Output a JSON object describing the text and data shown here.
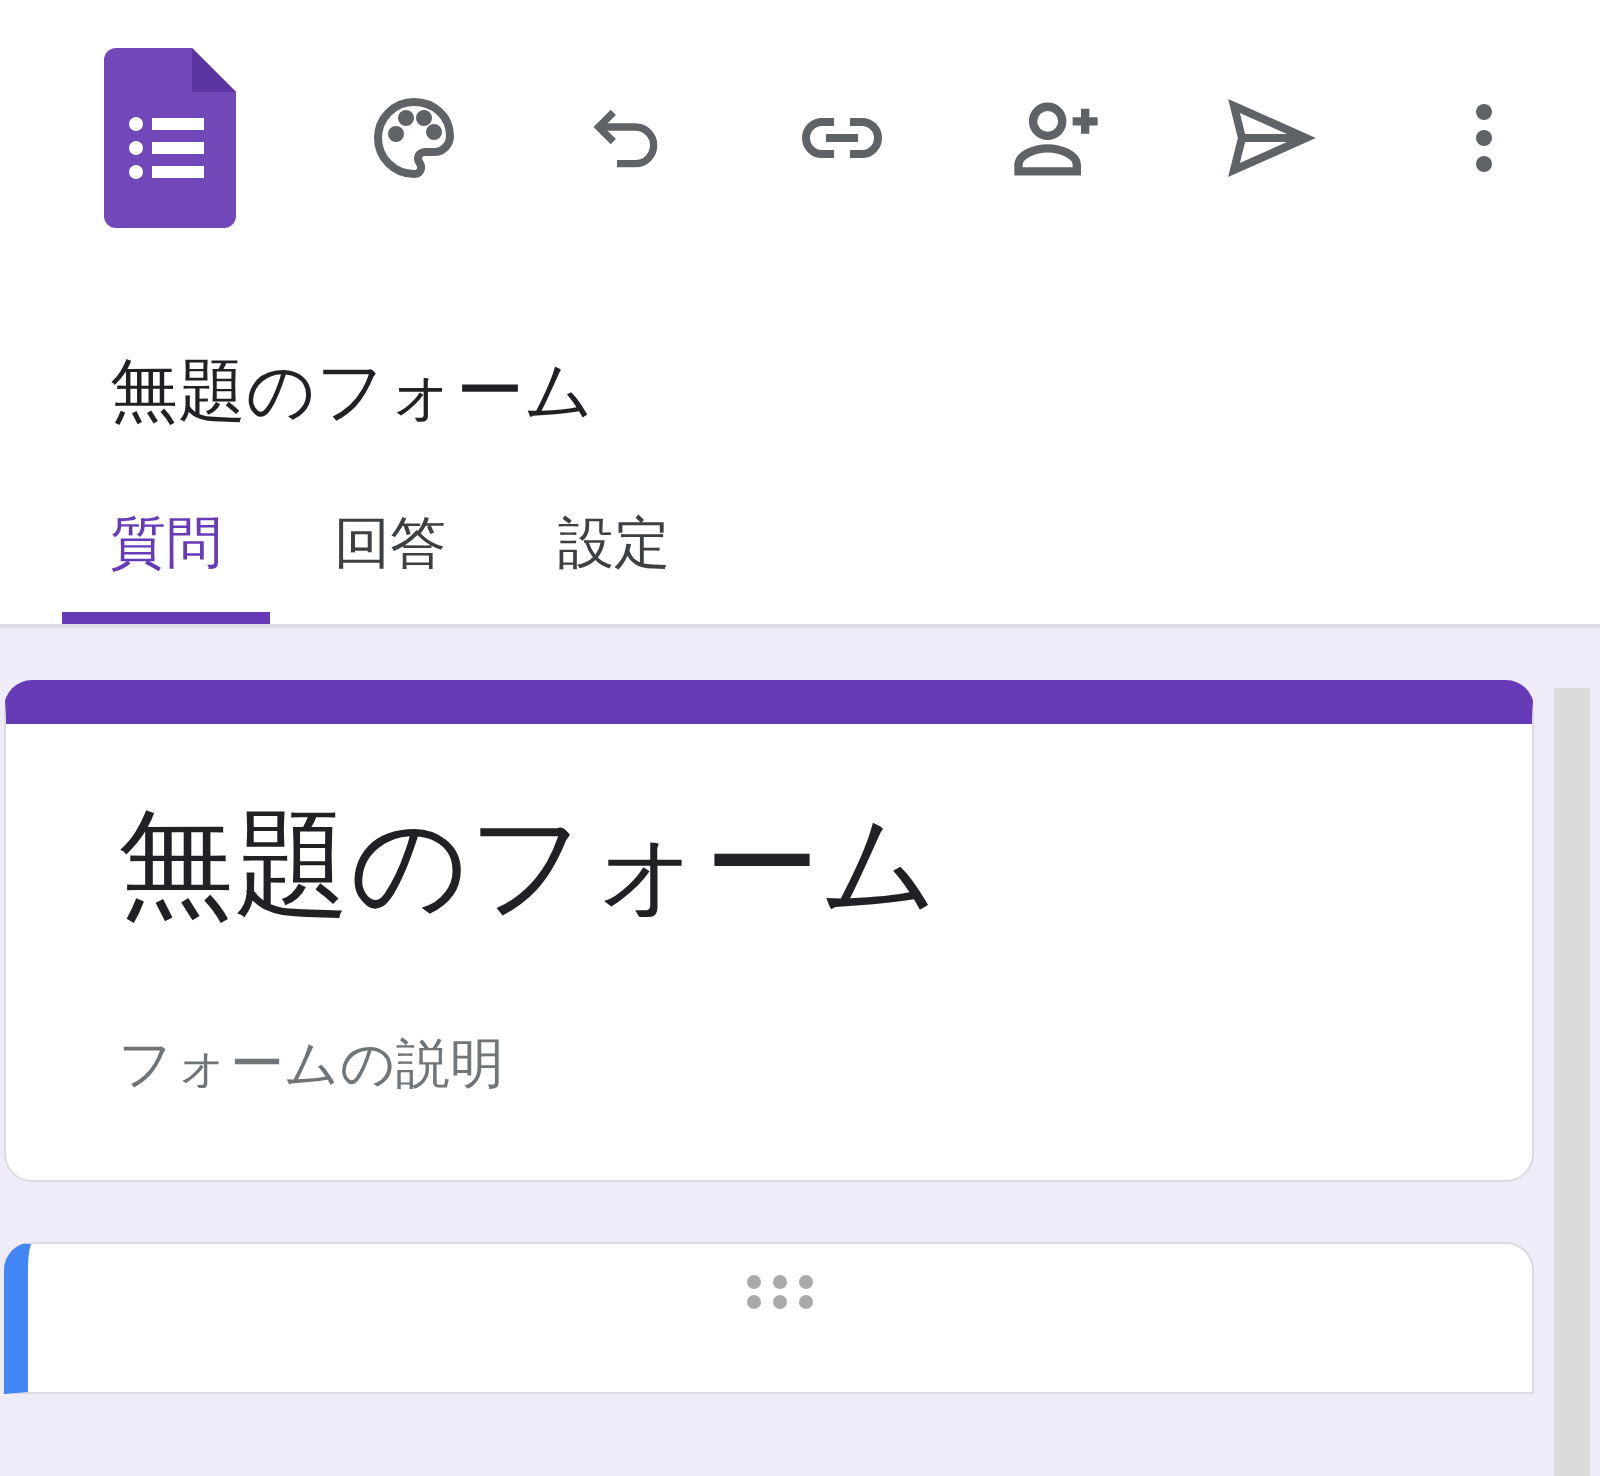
{
  "header": {
    "title": "無題のフォーム"
  },
  "tabs": [
    {
      "label": "質問",
      "selected": true
    },
    {
      "label": "回答",
      "selected": false
    },
    {
      "label": "設定",
      "selected": false
    }
  ],
  "form": {
    "title": "無題のフォーム",
    "description": "フォームの説明"
  }
}
